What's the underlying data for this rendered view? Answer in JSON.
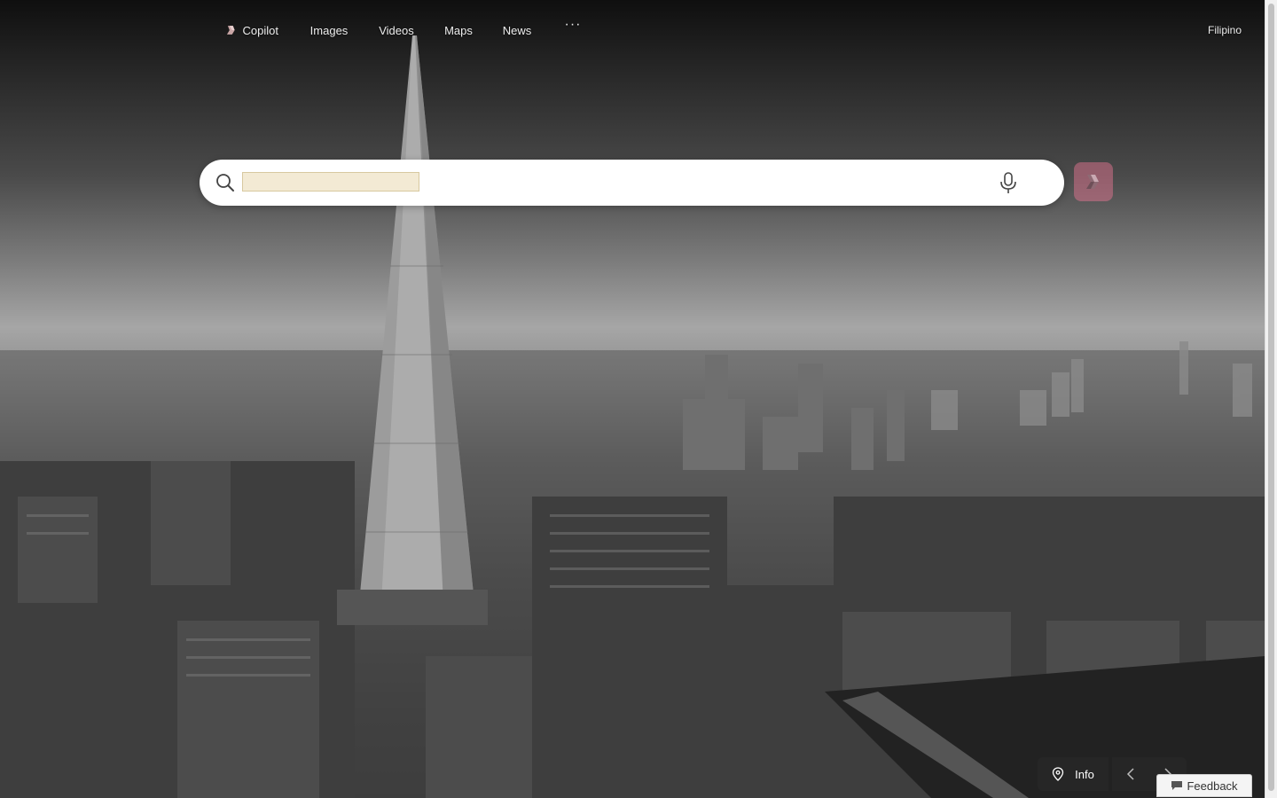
{
  "nav": {
    "items": [
      {
        "label": "Copilot"
      },
      {
        "label": "Images"
      },
      {
        "label": "Videos"
      },
      {
        "label": "Maps"
      },
      {
        "label": "News"
      }
    ],
    "more_label": "···",
    "language_label": "Filipino"
  },
  "search": {
    "placeholder": "",
    "value": ""
  },
  "footer": {
    "info_label": "Info",
    "feedback_label": "Feedback"
  },
  "icons": {
    "search": "search-icon",
    "microphone": "microphone-icon",
    "copilot": "copilot-icon",
    "location_pin": "location-pin-icon",
    "chevron_left": "chevron-left-icon",
    "chevron_right": "chevron-right-icon",
    "feedback": "feedback-icon"
  },
  "colors": {
    "copilot_button": "#f0a0b8",
    "search_bar": "#ffffff",
    "background_tint": "grayscale"
  }
}
